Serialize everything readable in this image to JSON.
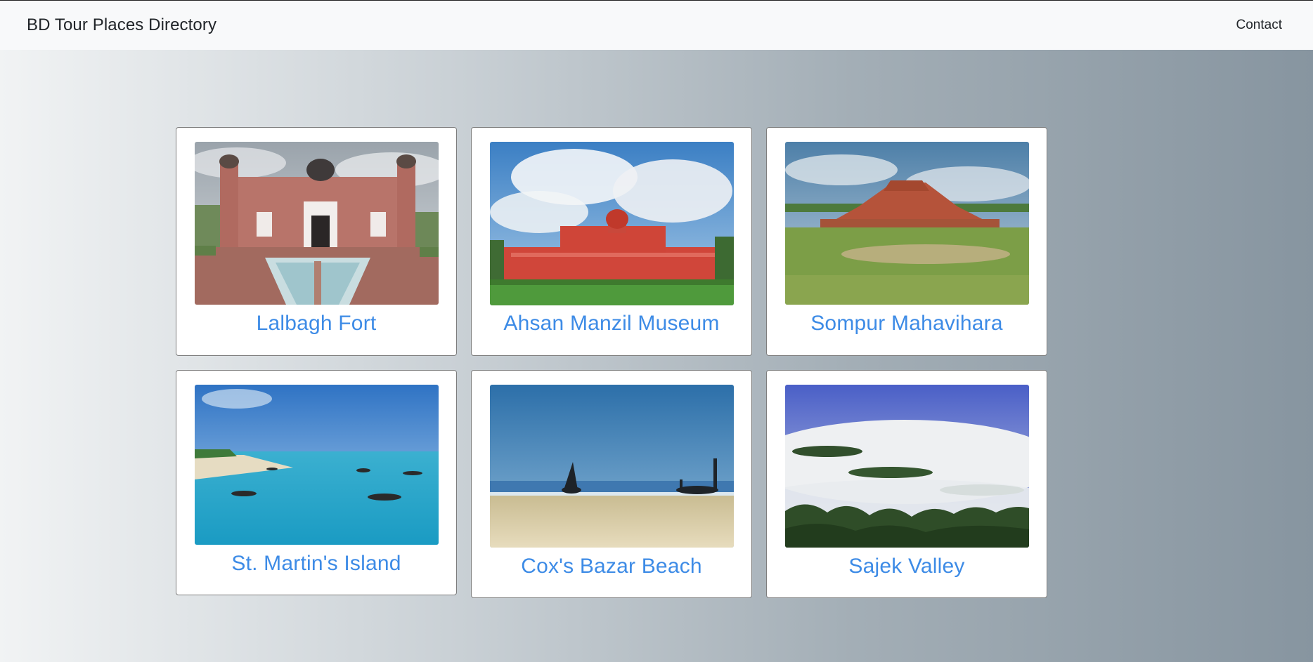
{
  "navbar": {
    "brand": "BD Tour Places Directory",
    "contact_label": "Contact"
  },
  "places": [
    {
      "name": "Lalbagh Fort",
      "image": "lalbagh-fort-photo"
    },
    {
      "name": "Ahsan Manzil Museum",
      "image": "ahsan-manzil-photo"
    },
    {
      "name": "Sompur Mahavihara",
      "image": "sompur-mahavihara-photo"
    },
    {
      "name": "St. Martin's Island",
      "image": "st-martins-island-photo"
    },
    {
      "name": "Cox's Bazar Beach",
      "image": "coxs-bazar-beach-photo"
    },
    {
      "name": "Sajek Valley",
      "image": "sajek-valley-photo"
    }
  ],
  "colors": {
    "title_link": "#3d8be6",
    "navbar_bg": "#f8f9fa"
  }
}
